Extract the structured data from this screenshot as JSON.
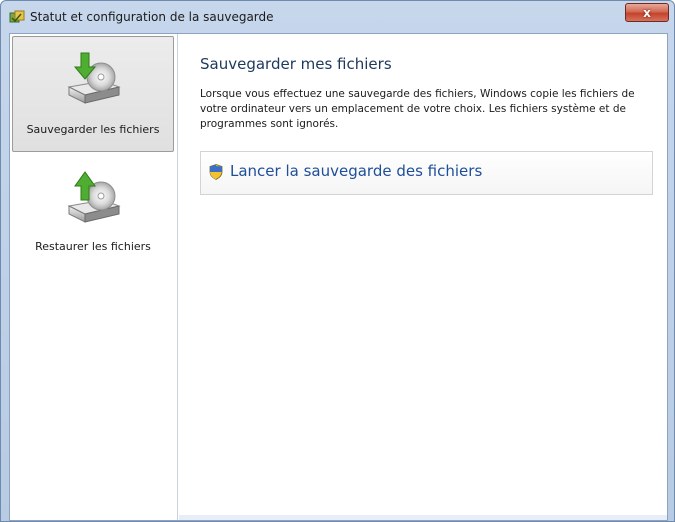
{
  "window": {
    "title": "Statut et configuration de la sauvegarde",
    "close_label": "x"
  },
  "sidebar": {
    "items": [
      {
        "label": "Sauvegarder les fichiers",
        "icon": "backup-drive-icon",
        "selected": true
      },
      {
        "label": "Restaurer les fichiers",
        "icon": "restore-drive-icon",
        "selected": false
      }
    ]
  },
  "main": {
    "heading": "Sauvegarder mes fichiers",
    "description": "Lorsque vous effectuez une sauvegarde des fichiers, Windows copie les fichiers de votre ordinateur vers un emplacement de votre choix. Les fichiers système et de programmes sont ignorés.",
    "action": {
      "label": "Lancer la sauvegarde des fichiers",
      "icon": "uac-shield-icon"
    }
  },
  "colors": {
    "heading": "#1e395b",
    "link": "#1f4e9a",
    "title_bar": "#c6d7ec",
    "close_button": "#c4432c"
  }
}
